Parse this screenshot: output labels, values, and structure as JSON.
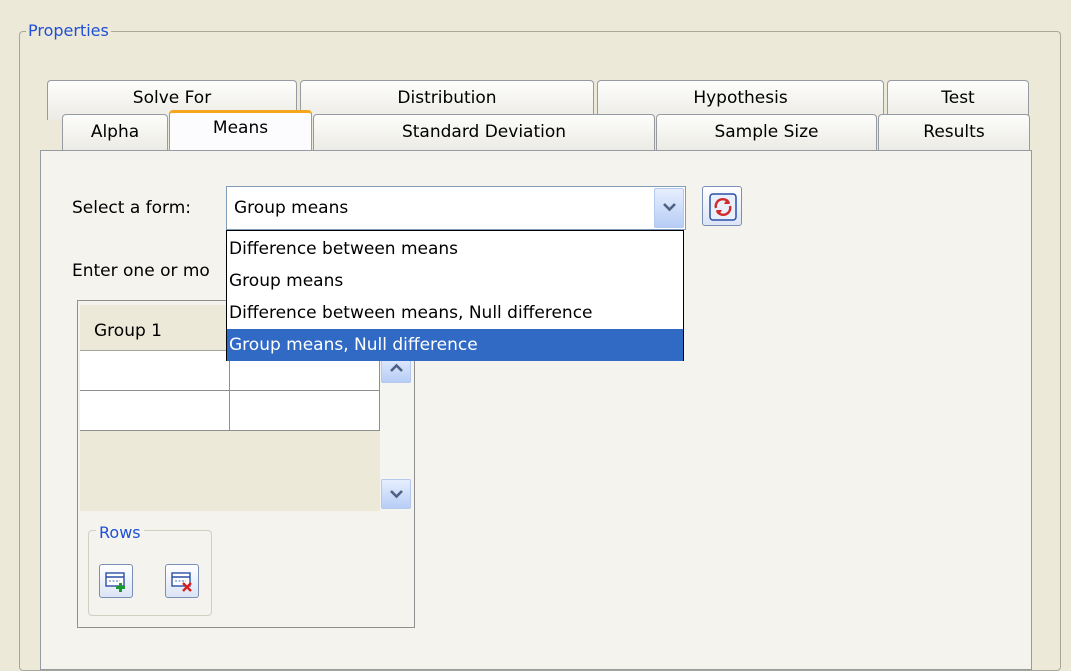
{
  "properties_title": "Properties",
  "tabs_back": [
    "Solve For",
    "Distribution",
    "Hypothesis",
    "Test"
  ],
  "tabs_front": [
    "Alpha",
    "Means",
    "Standard Deviation",
    "Sample Size",
    "Results"
  ],
  "active_tab": "Means",
  "form": {
    "label": "Select a form:",
    "selected": "Group means",
    "options": [
      "Difference between means",
      "Group means",
      "Difference between means, Null difference",
      "Group means, Null difference"
    ],
    "highlighted_option": "Group means, Null difference"
  },
  "enter_text": "Enter one or mo",
  "grid": {
    "columns": [
      "Group 1",
      ""
    ]
  },
  "rows_group": {
    "title": "Rows",
    "add_icon": "add-row-icon",
    "delete_icon": "delete-row-icon"
  },
  "icons": {
    "refresh": "refresh-icon",
    "dropdown": "chevron-down-icon"
  },
  "colors": {
    "background": "#ece9d8",
    "group_title": "#1f4fd6",
    "active_tab_accent": "#f4a71c",
    "selection": "#316ac5"
  }
}
